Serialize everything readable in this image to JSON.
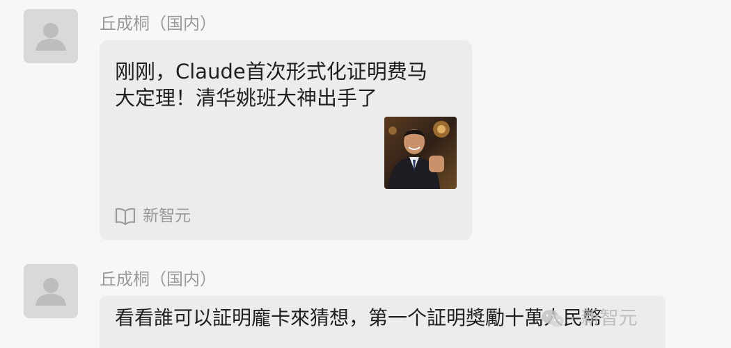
{
  "messages": [
    {
      "sender": "丘成桐（国内）",
      "card": {
        "title": "刚刚，Claude首次形式化证明费马大定理！清华姚班大神出手了",
        "source": "新智元",
        "source_icon": "book-icon",
        "thumbnail": "photo of a man in a suit"
      }
    },
    {
      "sender": "丘成桐（国内）",
      "text": "看看誰可以証明龐卡來猜想，第一个証明獎勵十萬人民幣"
    }
  ],
  "watermark": {
    "logo": "wechat-icon",
    "dot": "·",
    "text": "新智元"
  }
}
